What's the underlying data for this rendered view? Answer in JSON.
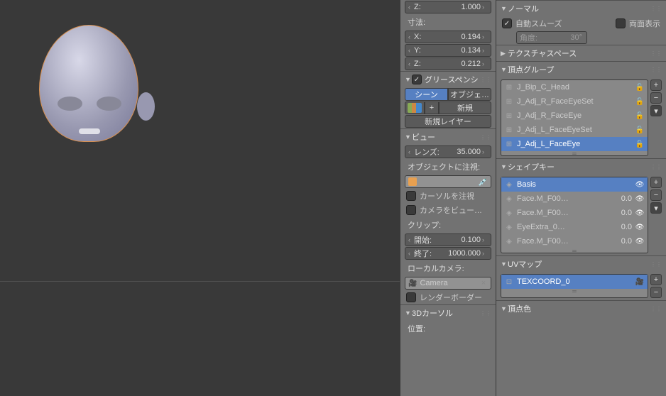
{
  "transform": {
    "z_label": "Z:",
    "z_value": "1.000",
    "dim_label": "寸法:",
    "dim_x_label": "X:",
    "dim_x": "0.194",
    "dim_y_label": "Y:",
    "dim_y": "0.134",
    "dim_z_label": "Z:",
    "dim_z": "0.212"
  },
  "gp": {
    "title": "グリースペンシ",
    "scene": "シーン",
    "object": "オブジェ…",
    "new": "新規",
    "new_layer": "新規レイヤー"
  },
  "view": {
    "title": "ビュー",
    "lens_label": "レンズ:",
    "lens": "35.000",
    "focus_label": "オブジェクトに注視:",
    "cursor_focus": "カーソルを注視",
    "camera_to_view": "カメラをビュー…",
    "clip_label": "クリップ:",
    "start_label": "開始:",
    "start": "0.100",
    "end_label": "終了:",
    "end": "1000.000",
    "local_cam_label": "ローカルカメラ:",
    "camera": "Camera",
    "render_border": "レンダーボーダー"
  },
  "cursor3d": {
    "title": "3Dカーソル",
    "pos_label": "位置:"
  },
  "normals": {
    "title": "ノーマル",
    "auto_smooth": "自動スムーズ",
    "double_sided": "両面表示",
    "angle_label": "角度:",
    "angle": "30°"
  },
  "texspace": {
    "title": "テクスチャスペース"
  },
  "vgroups": {
    "title": "頂点グループ",
    "items": [
      {
        "name": "J_Bip_C_Head"
      },
      {
        "name": "J_Adj_R_FaceEyeSet"
      },
      {
        "name": "J_Adj_R_FaceEye"
      },
      {
        "name": "J_Adj_L_FaceEyeSet"
      },
      {
        "name": "J_Adj_L_FaceEye"
      }
    ]
  },
  "shapekeys": {
    "title": "シェイプキー",
    "items": [
      {
        "name": "Basis",
        "value": ""
      },
      {
        "name": "Face.M_F00…",
        "value": "0.0"
      },
      {
        "name": "Face.M_F00…",
        "value": "0.0"
      },
      {
        "name": "EyeExtra_0…",
        "value": "0.0"
      },
      {
        "name": "Face.M_F00…",
        "value": "0.0"
      }
    ]
  },
  "uvmap": {
    "title": "UVマップ",
    "name": "TEXCOORD_0"
  },
  "vcolor": {
    "title": "頂点色"
  }
}
